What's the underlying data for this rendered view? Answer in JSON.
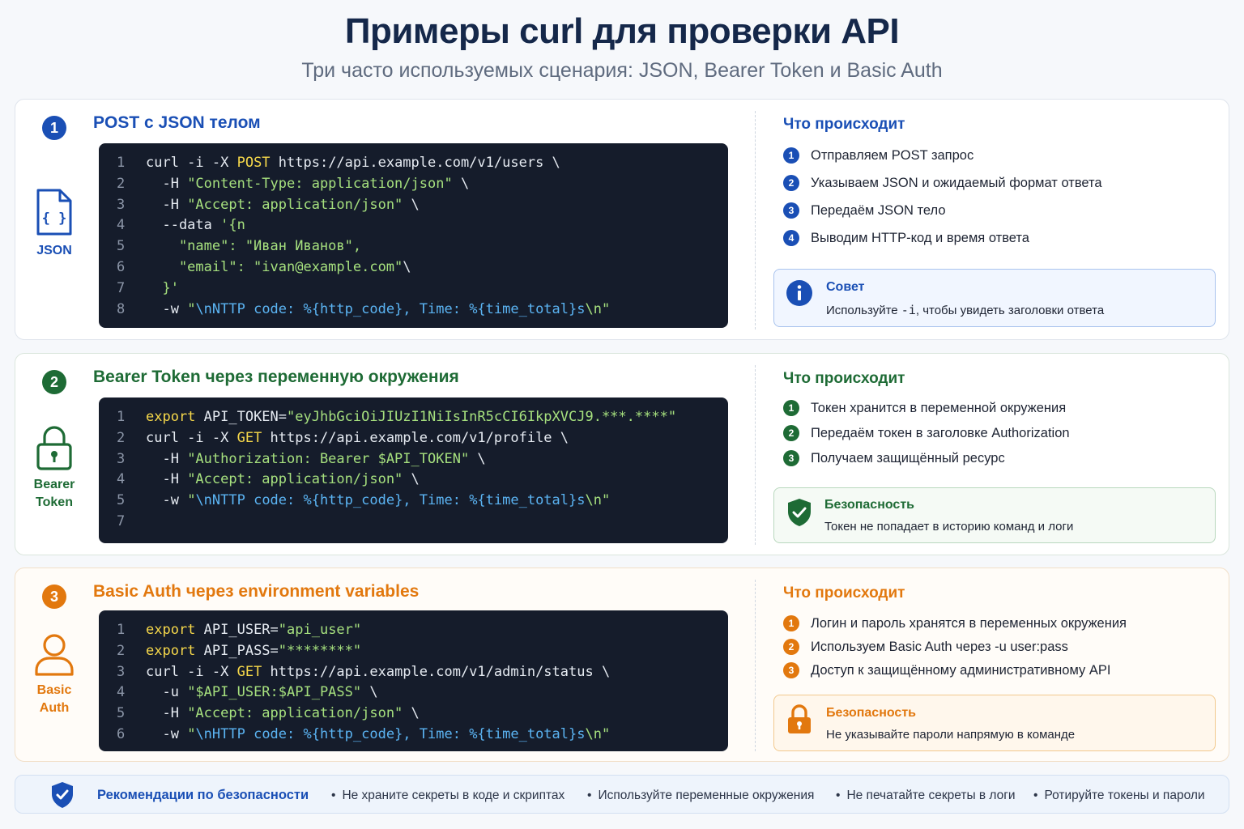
{
  "header": {
    "title": "Примеры curl для проверки API",
    "subtitle": "Три часто используемых сценария: JSON, Bearer Token и Basic Auth"
  },
  "sections": [
    {
      "number": "1",
      "title": "POST с JSON телом",
      "side_label_1": "JSON",
      "side_label_2": "",
      "code": [
        {
          "n": "1",
          "parts": [
            [
              "",
              "curl -i -X "
            ],
            [
              "kw",
              "POST"
            ],
            [
              "",
              " https://api.example.com/v1/users \\"
            ]
          ]
        },
        {
          "n": "2",
          "parts": [
            [
              "",
              "  -H "
            ],
            [
              "str",
              "\"Content-Type: application/json\""
            ],
            [
              "",
              " \\"
            ]
          ]
        },
        {
          "n": "3",
          "parts": [
            [
              "",
              "  -H "
            ],
            [
              "str",
              "\"Accept: application/json\""
            ],
            [
              "",
              " \\"
            ]
          ]
        },
        {
          "n": "4",
          "parts": [
            [
              "",
              "  --data "
            ],
            [
              "str",
              "'{n"
            ]
          ]
        },
        {
          "n": "5",
          "parts": [
            [
              "str",
              "    \"name\": \"Иван Иванов\","
            ]
          ]
        },
        {
          "n": "6",
          "parts": [
            [
              "str",
              "    \"email\": \"ivan@example.com\""
            ],
            [
              "",
              "\\"
            ]
          ]
        },
        {
          "n": "7",
          "parts": [
            [
              "str",
              "  }'"
            ]
          ]
        },
        {
          "n": "8",
          "parts": [
            [
              "",
              "  -w "
            ],
            [
              "str",
              "\""
            ],
            [
              "fmt",
              "\\nNTTP code: %{http_code}, Time: %{time_total}s"
            ],
            [
              "str",
              "\\n\""
            ]
          ]
        }
      ],
      "what_title": "Что происходит",
      "steps": [
        "Отправляем POST запрос",
        "Указываем JSON и ожидаемый формат ответа",
        "Передаём JSON тело",
        "Выводим HTTP-код и время ответа"
      ],
      "tip_title": "Совет",
      "tip_text_before": "Используйте ",
      "tip_text_code": "-i",
      "tip_text_after": ", чтобы увидеть заголовки ответа"
    },
    {
      "number": "2",
      "title": "Bearer Token через переменную окружения",
      "side_label_1": "Bearer",
      "side_label_2": "Token",
      "code": [
        {
          "n": "1",
          "parts": [
            [
              "kw",
              "export"
            ],
            [
              "",
              " API_TOKEN="
            ],
            [
              "str",
              "\"eyJhbGciOiJIUzI1NiIsInR5cCI6IkpXVCJ9.***.****\""
            ]
          ]
        },
        {
          "n": "2",
          "parts": [
            [
              "",
              "curl -i -X "
            ],
            [
              "kw",
              "GET"
            ],
            [
              "",
              " https://api.example.com/v1/profile \\"
            ]
          ]
        },
        {
          "n": "3",
          "parts": [
            [
              "",
              "  -H "
            ],
            [
              "str",
              "\"Authorization: Bearer $API_TOKEN\""
            ],
            [
              "",
              " \\"
            ]
          ]
        },
        {
          "n": "4",
          "parts": [
            [
              "",
              "  -H "
            ],
            [
              "str",
              "\"Accept: application/json\""
            ],
            [
              "",
              " \\"
            ]
          ]
        },
        {
          "n": "5",
          "parts": [
            [
              "",
              "  -w "
            ],
            [
              "str",
              "\""
            ],
            [
              "fmt",
              "\\nNTTP code: %{http_code}, Time: %{time_total}s"
            ],
            [
              "str",
              "\\n\""
            ]
          ]
        },
        {
          "n": "7",
          "parts": [
            [
              "",
              ""
            ]
          ]
        }
      ],
      "what_title": "Что происходит",
      "steps": [
        "Токен хранится в переменной окружения",
        "Передаём токен в заголовке Authorization",
        "Получаем защищённый ресурс"
      ],
      "tip_title": "Безопасность",
      "tip_text": "Токен не попадает в историю команд и логи"
    },
    {
      "number": "3",
      "title": "Basic Auth через environment variables",
      "side_label_1": "Basic",
      "side_label_2": "Auth",
      "code": [
        {
          "n": "1",
          "parts": [
            [
              "kw",
              "export"
            ],
            [
              "",
              " API_USER="
            ],
            [
              "str",
              "\"api_user\""
            ]
          ]
        },
        {
          "n": "2",
          "parts": [
            [
              "kw",
              "export"
            ],
            [
              "",
              " API_PASS="
            ],
            [
              "str",
              "\"********\""
            ]
          ]
        },
        {
          "n": "3",
          "parts": [
            [
              "",
              "curl -i -X "
            ],
            [
              "kw",
              "GET"
            ],
            [
              "",
              " https://api.example.com/v1/admin/status \\"
            ]
          ]
        },
        {
          "n": "4",
          "parts": [
            [
              "",
              "  -u "
            ],
            [
              "str",
              "\"$API_USER:$API_PASS\""
            ],
            [
              "",
              " \\"
            ]
          ]
        },
        {
          "n": "5",
          "parts": [
            [
              "",
              "  -H "
            ],
            [
              "str",
              "\"Accept: application/json\""
            ],
            [
              "",
              " \\"
            ]
          ]
        },
        {
          "n": "6",
          "parts": [
            [
              "",
              "  -w "
            ],
            [
              "str",
              "\""
            ],
            [
              "fmt",
              "\\nHTTP code: %{http_code}, Time: %{time_total}s"
            ],
            [
              "str",
              "\\n\""
            ]
          ]
        }
      ],
      "what_title": "Что происходит",
      "steps": [
        "Логин и пароль хранятся в переменных окружения",
        "Используем Basic Auth через -u user:pass",
        "Доступ к защищённому административному API"
      ],
      "tip_title": "Безопасность",
      "tip_text": "Не указывайте пароли напрямую в команде"
    }
  ],
  "footer": {
    "title": "Рекомендации по безопасности",
    "items": [
      "Не храните секреты в коде и скриптах",
      "Используйте переменные окружения",
      "Не печатайте секреты в логи",
      "Ротируйте токены и пароли"
    ]
  },
  "colors": {
    "blue": "#1a4fb5",
    "green": "#1e6b35",
    "orange": "#e2780e",
    "code_bg": "#151c2b"
  },
  "icons": [
    "json-file-icon",
    "lock-icon",
    "user-icon",
    "info-icon",
    "shield-check-icon",
    "padlock-icon",
    "shield-icon"
  ]
}
